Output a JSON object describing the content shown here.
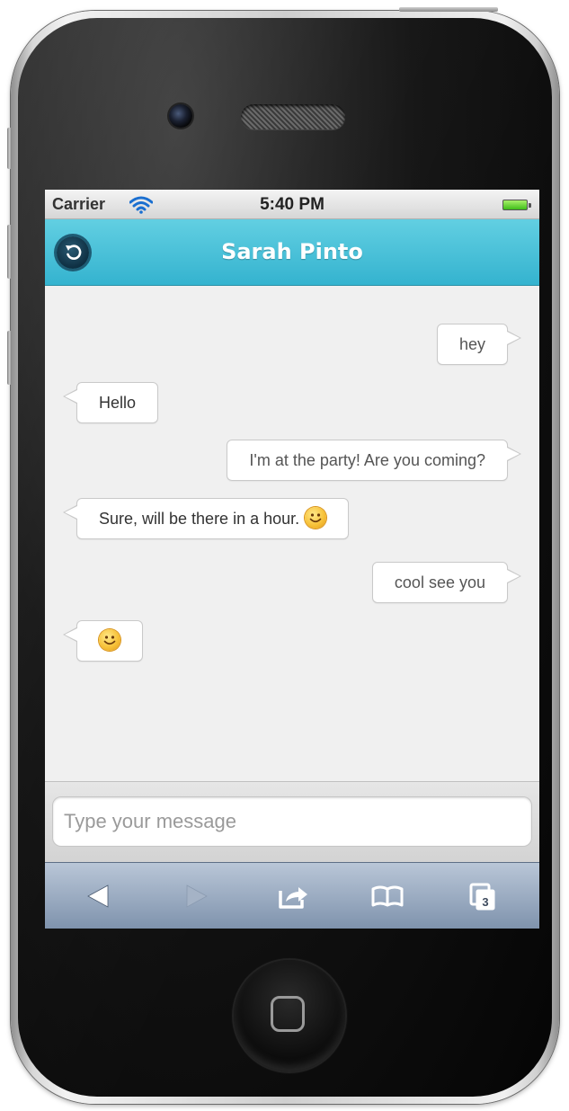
{
  "status_bar": {
    "carrier": "Carrier",
    "time": "5:40 PM"
  },
  "nav_bar": {
    "title": "Sarah Pinto",
    "back_icon": "back-arrow-icon"
  },
  "messages": [
    {
      "direction": "out",
      "text": "hey"
    },
    {
      "direction": "in",
      "text": "Hello"
    },
    {
      "direction": "out",
      "text": "I'm at the party! Are you coming?"
    },
    {
      "direction": "in",
      "text": "Sure, will be there in a hour.",
      "emoji": "smiley-icon"
    },
    {
      "direction": "out",
      "text": "cool see you"
    },
    {
      "direction": "in",
      "text": "",
      "emoji": "smiley-icon"
    }
  ],
  "composer": {
    "placeholder": "Type your message",
    "value": ""
  },
  "toolbar": {
    "items": [
      "back-icon",
      "forward-icon",
      "share-icon",
      "bookmarks-icon",
      "tabs-icon"
    ],
    "tabs_count": "3"
  },
  "colors": {
    "nav_bar": "#45c0d8",
    "screen_background": "#f0f0f0",
    "toolbar": "#9aabc2"
  }
}
